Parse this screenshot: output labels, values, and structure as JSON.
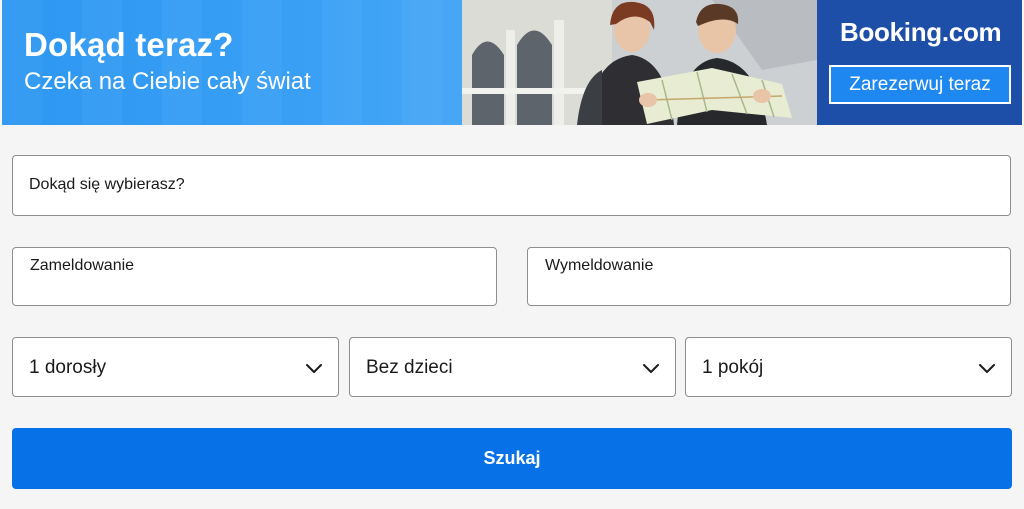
{
  "banner": {
    "title": "Dokąd teraz?",
    "subtitle": "Czeka na Ciebie cały świat",
    "brand": "Booking.com",
    "cta_label": "Zarezerwuj teraz",
    "colors": {
      "left_bg": "#2d97f2",
      "right_bg": "#1e4fa8",
      "cta_bg": "#1e88f0"
    }
  },
  "search_form": {
    "destination_placeholder": "Dokąd się wybierasz?",
    "checkin": {
      "label": "Zameldowanie",
      "value": ""
    },
    "checkout": {
      "label": "Wymeldowanie",
      "value": ""
    },
    "adults": {
      "selected": "1 dorosły",
      "icon": "chevron-down-icon"
    },
    "children": {
      "selected": "Bez dzieci",
      "icon": "chevron-down-icon"
    },
    "rooms": {
      "selected": "1 pokój",
      "icon": "chevron-down-icon"
    },
    "search_label": "Szukaj",
    "colors": {
      "search_bg": "#0771e8",
      "field_border": "#8e8e8e"
    }
  }
}
